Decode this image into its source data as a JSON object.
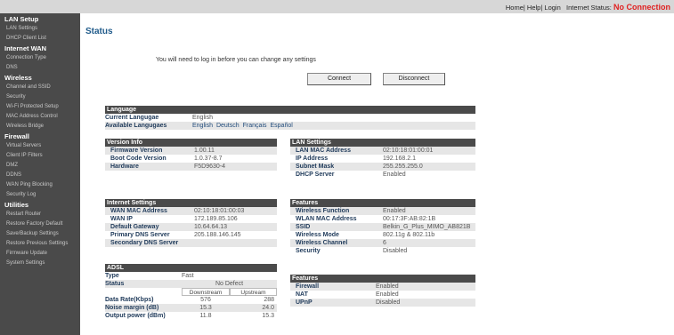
{
  "topbar": {
    "home": "Home",
    "help": "Help",
    "login": "Login",
    "status_label": "Internet Status:",
    "status_value": "No Connection"
  },
  "sidebar": [
    {
      "type": "head",
      "label": "LAN Setup"
    },
    {
      "type": "item",
      "label": "LAN Settings"
    },
    {
      "type": "item",
      "label": "DHCP Client List"
    },
    {
      "type": "head",
      "label": "Internet WAN"
    },
    {
      "type": "item",
      "label": "Connection Type"
    },
    {
      "type": "item",
      "label": "DNS"
    },
    {
      "type": "head",
      "label": "Wireless"
    },
    {
      "type": "item",
      "label": "Channel and SSID"
    },
    {
      "type": "item",
      "label": "Security"
    },
    {
      "type": "item",
      "label": "Wi-Fi Protected Setup"
    },
    {
      "type": "item",
      "label": "MAC Address Control"
    },
    {
      "type": "item",
      "label": "Wireless Bridge"
    },
    {
      "type": "head",
      "label": "Firewall"
    },
    {
      "type": "item",
      "label": "Virtual Servers"
    },
    {
      "type": "item",
      "label": "Client IP Filters"
    },
    {
      "type": "item",
      "label": "DMZ"
    },
    {
      "type": "item",
      "label": "DDNS"
    },
    {
      "type": "item",
      "label": "WAN Ping Blocking"
    },
    {
      "type": "item",
      "label": "Security Log"
    },
    {
      "type": "head",
      "label": "Utilities"
    },
    {
      "type": "item",
      "label": "Restart Router"
    },
    {
      "type": "item",
      "label": "Restore Factory Default"
    },
    {
      "type": "item",
      "label": "Save/Backup Settings"
    },
    {
      "type": "item",
      "label": "Restore Previous Settings"
    },
    {
      "type": "item",
      "label": "Firmware Update"
    },
    {
      "type": "item",
      "label": "System Settings"
    }
  ],
  "main": {
    "title": "Status",
    "login_message": "You will need to log in before you can change any settings",
    "connect_label": "Connect",
    "disconnect_label": "Disconnect"
  },
  "language": {
    "title": "Language",
    "current_label": "Current Langugae",
    "current_value": "English",
    "available_label": "Available Langugaes",
    "options": [
      "English",
      "Deutsch",
      "Français",
      "Español"
    ]
  },
  "version_info": {
    "title": "Version Info",
    "rows": [
      {
        "k": "Firmware Version",
        "v": "1.00.11"
      },
      {
        "k": "Boot Code Version",
        "v": "1.0.37-8.7"
      },
      {
        "k": "Hardware",
        "v": "F5D9630-4"
      }
    ]
  },
  "lan_settings": {
    "title": "LAN Settings",
    "rows": [
      {
        "k": "LAN MAC Address",
        "v": "02:10:18:01:00:01"
      },
      {
        "k": "IP Address",
        "v": "192.168.2.1"
      },
      {
        "k": "Subnet Mask",
        "v": "255.255.255.0"
      },
      {
        "k": "DHCP Server",
        "v": "Enabled"
      }
    ]
  },
  "internet_settings": {
    "title": "Internet Settings",
    "rows": [
      {
        "k": "WAN MAC Address",
        "v": "02:10:18:01:00:03"
      },
      {
        "k": "WAN IP",
        "v": "172.189.85.106"
      },
      {
        "k": "Default Gateway",
        "v": "10.64.64.13"
      },
      {
        "k": "Primary DNS Server",
        "v": "205.188.146.145"
      },
      {
        "k": "Secondary DNS Server",
        "v": ""
      }
    ]
  },
  "features_wireless": {
    "title": "Features",
    "rows": [
      {
        "k": "Wireless Function",
        "v": "Enabled"
      },
      {
        "k": "WLAN MAC Address",
        "v": "00:17:3F:AB:82:1B"
      },
      {
        "k": "SSID",
        "v": "Belkin_G_Plus_MIMO_AB821B"
      },
      {
        "k": "Wireless Mode",
        "v": "802.11g & 802.11b"
      },
      {
        "k": "Wireless Channel",
        "v": "6"
      },
      {
        "k": "Security",
        "v": "Disabled"
      }
    ]
  },
  "adsl": {
    "title": "ADSL",
    "type_label": "Type",
    "type_value": "Fast",
    "status_label": "Status",
    "status_value": "No Defect",
    "downstream": "Downstream",
    "upstream": "Upstream",
    "rows": [
      {
        "k": "Data Rate(Kbps)",
        "down": "576",
        "up": "288"
      },
      {
        "k": "Noise margin (dB)",
        "down": "15.3",
        "up": "24.0"
      },
      {
        "k": "Output power (dBm)",
        "down": "11.8",
        "up": "15.3"
      }
    ]
  },
  "features_firewall": {
    "title": "Features",
    "rows": [
      {
        "k": "Firewall",
        "v": "Enabled"
      },
      {
        "k": "NAT",
        "v": "Enabled"
      },
      {
        "k": "UPnP",
        "v": "Disabled"
      }
    ]
  }
}
